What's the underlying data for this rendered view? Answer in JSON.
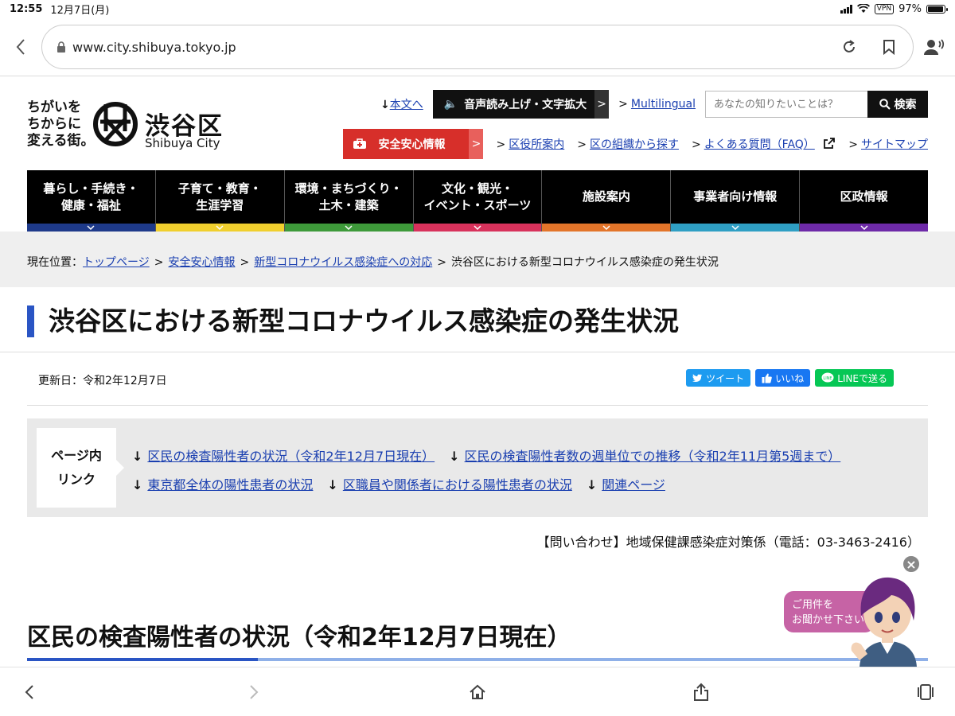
{
  "status": {
    "time": "12:55",
    "date": "12月7日(月)",
    "vpn": "VPN",
    "battery": "97%",
    "battery_level": 0.97
  },
  "browser": {
    "url": "www.city.shibuya.tokyo.jp"
  },
  "header": {
    "tagline": [
      "ちがいを",
      "ちからに",
      "変える街。"
    ],
    "logo_name": "渋谷区",
    "logo_en": "Shibuya City",
    "skip_link": "本文へ",
    "voice_button": "音声読み上げ・文字拡大",
    "multilingual": "Multilingual",
    "search_placeholder": "あなたの知りたいことは？",
    "search_button": "検索",
    "safety_button": "安全安心情報",
    "links": [
      "区役所案内",
      "区の組織から探す",
      "よくある質問（FAQ）",
      "サイトマップ"
    ]
  },
  "nav": [
    {
      "line1": "暮らし・手続き・",
      "line2": "健康・福祉",
      "color": "#1e3a8a"
    },
    {
      "line1": "子育て・教育・",
      "line2": "生涯学習",
      "color": "#f0cf2e"
    },
    {
      "line1": "環境・まちづくり・",
      "line2": "土木・建築",
      "color": "#3e9a3a"
    },
    {
      "line1": "文化・観光・",
      "line2": "イベント・スポーツ",
      "color": "#d8325c"
    },
    {
      "line1": "施設案内",
      "line2": "",
      "color": "#e3752a"
    },
    {
      "line1": "事業者向け情報",
      "line2": "",
      "color": "#2f9fc4"
    },
    {
      "line1": "区政情報",
      "line2": "",
      "color": "#6e2aa8"
    }
  ],
  "breadcrumb": {
    "prefix": "現在位置：",
    "items": [
      "トップページ",
      "安全安心情報",
      "新型コロナウイルス感染症への対応"
    ],
    "current": "渋谷区における新型コロナウイルス感染症の発生状況"
  },
  "page": {
    "title": "渋谷区における新型コロナウイルス感染症の発生状況",
    "updated": "更新日：令和2年12月7日",
    "share": {
      "tweet": "ツイート",
      "like": "いいね",
      "line": "LINEで送る"
    },
    "page_links_label": [
      "ページ内",
      "リンク"
    ],
    "page_links": [
      [
        "区民の検査陽性者の状況（令和2年12月7日現在）",
        "区民の検査陽性者数の週単位での推移（令和2年11月第5週まで）"
      ],
      [
        "東京都全体の陽性患者の状況",
        "区職員や関係者における陽性患者の状況",
        "関連ページ"
      ]
    ],
    "contact": "【問い合わせ】地域保健課感染症対策係（電話：03-3463-2416）",
    "section_heading": "区民の検査陽性者の状況（令和2年12月7日現在）"
  },
  "chat": {
    "bubble_line1": "ご用件を",
    "bubble_line2": "お聞かせ下さい"
  },
  "colors": {
    "accent": "#2a55c4",
    "safety": "#d72f2a",
    "link": "#1a3fb0"
  }
}
